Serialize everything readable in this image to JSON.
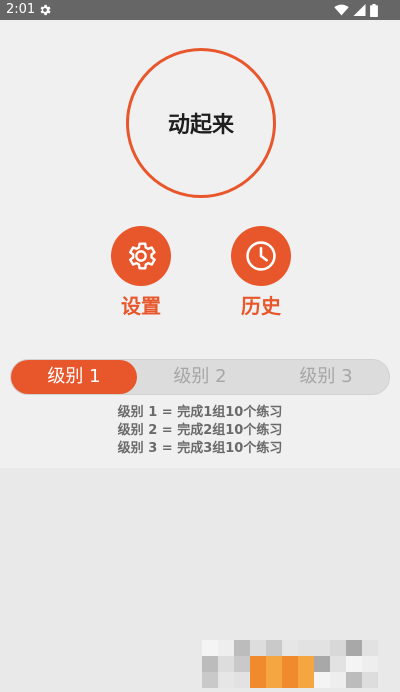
{
  "status_bar": {
    "time": "2:01",
    "icons": [
      "gear-icon",
      "wifi-icon",
      "signal-icon",
      "battery-icon"
    ],
    "background": "#666666"
  },
  "main": {
    "start_button_label": "动起来",
    "actions": [
      {
        "label": "设置",
        "icon": "gear-icon"
      },
      {
        "label": "历史",
        "icon": "clock-icon"
      }
    ]
  },
  "levels": {
    "options": [
      "级别 1",
      "级别 2",
      "级别 3"
    ],
    "selected_index": 0,
    "descriptions": [
      "级别 1 = 完成1组10个练习",
      "级别 2 = 完成2组10个练习",
      "级别 3 = 完成3组10个练习"
    ]
  },
  "colors": {
    "accent": "#e8572c",
    "background": "#f0f0f0",
    "segment_inactive": "#dcdcdc",
    "text_dark": "#1e1e1e",
    "text_muted": "#6a6a6a"
  }
}
